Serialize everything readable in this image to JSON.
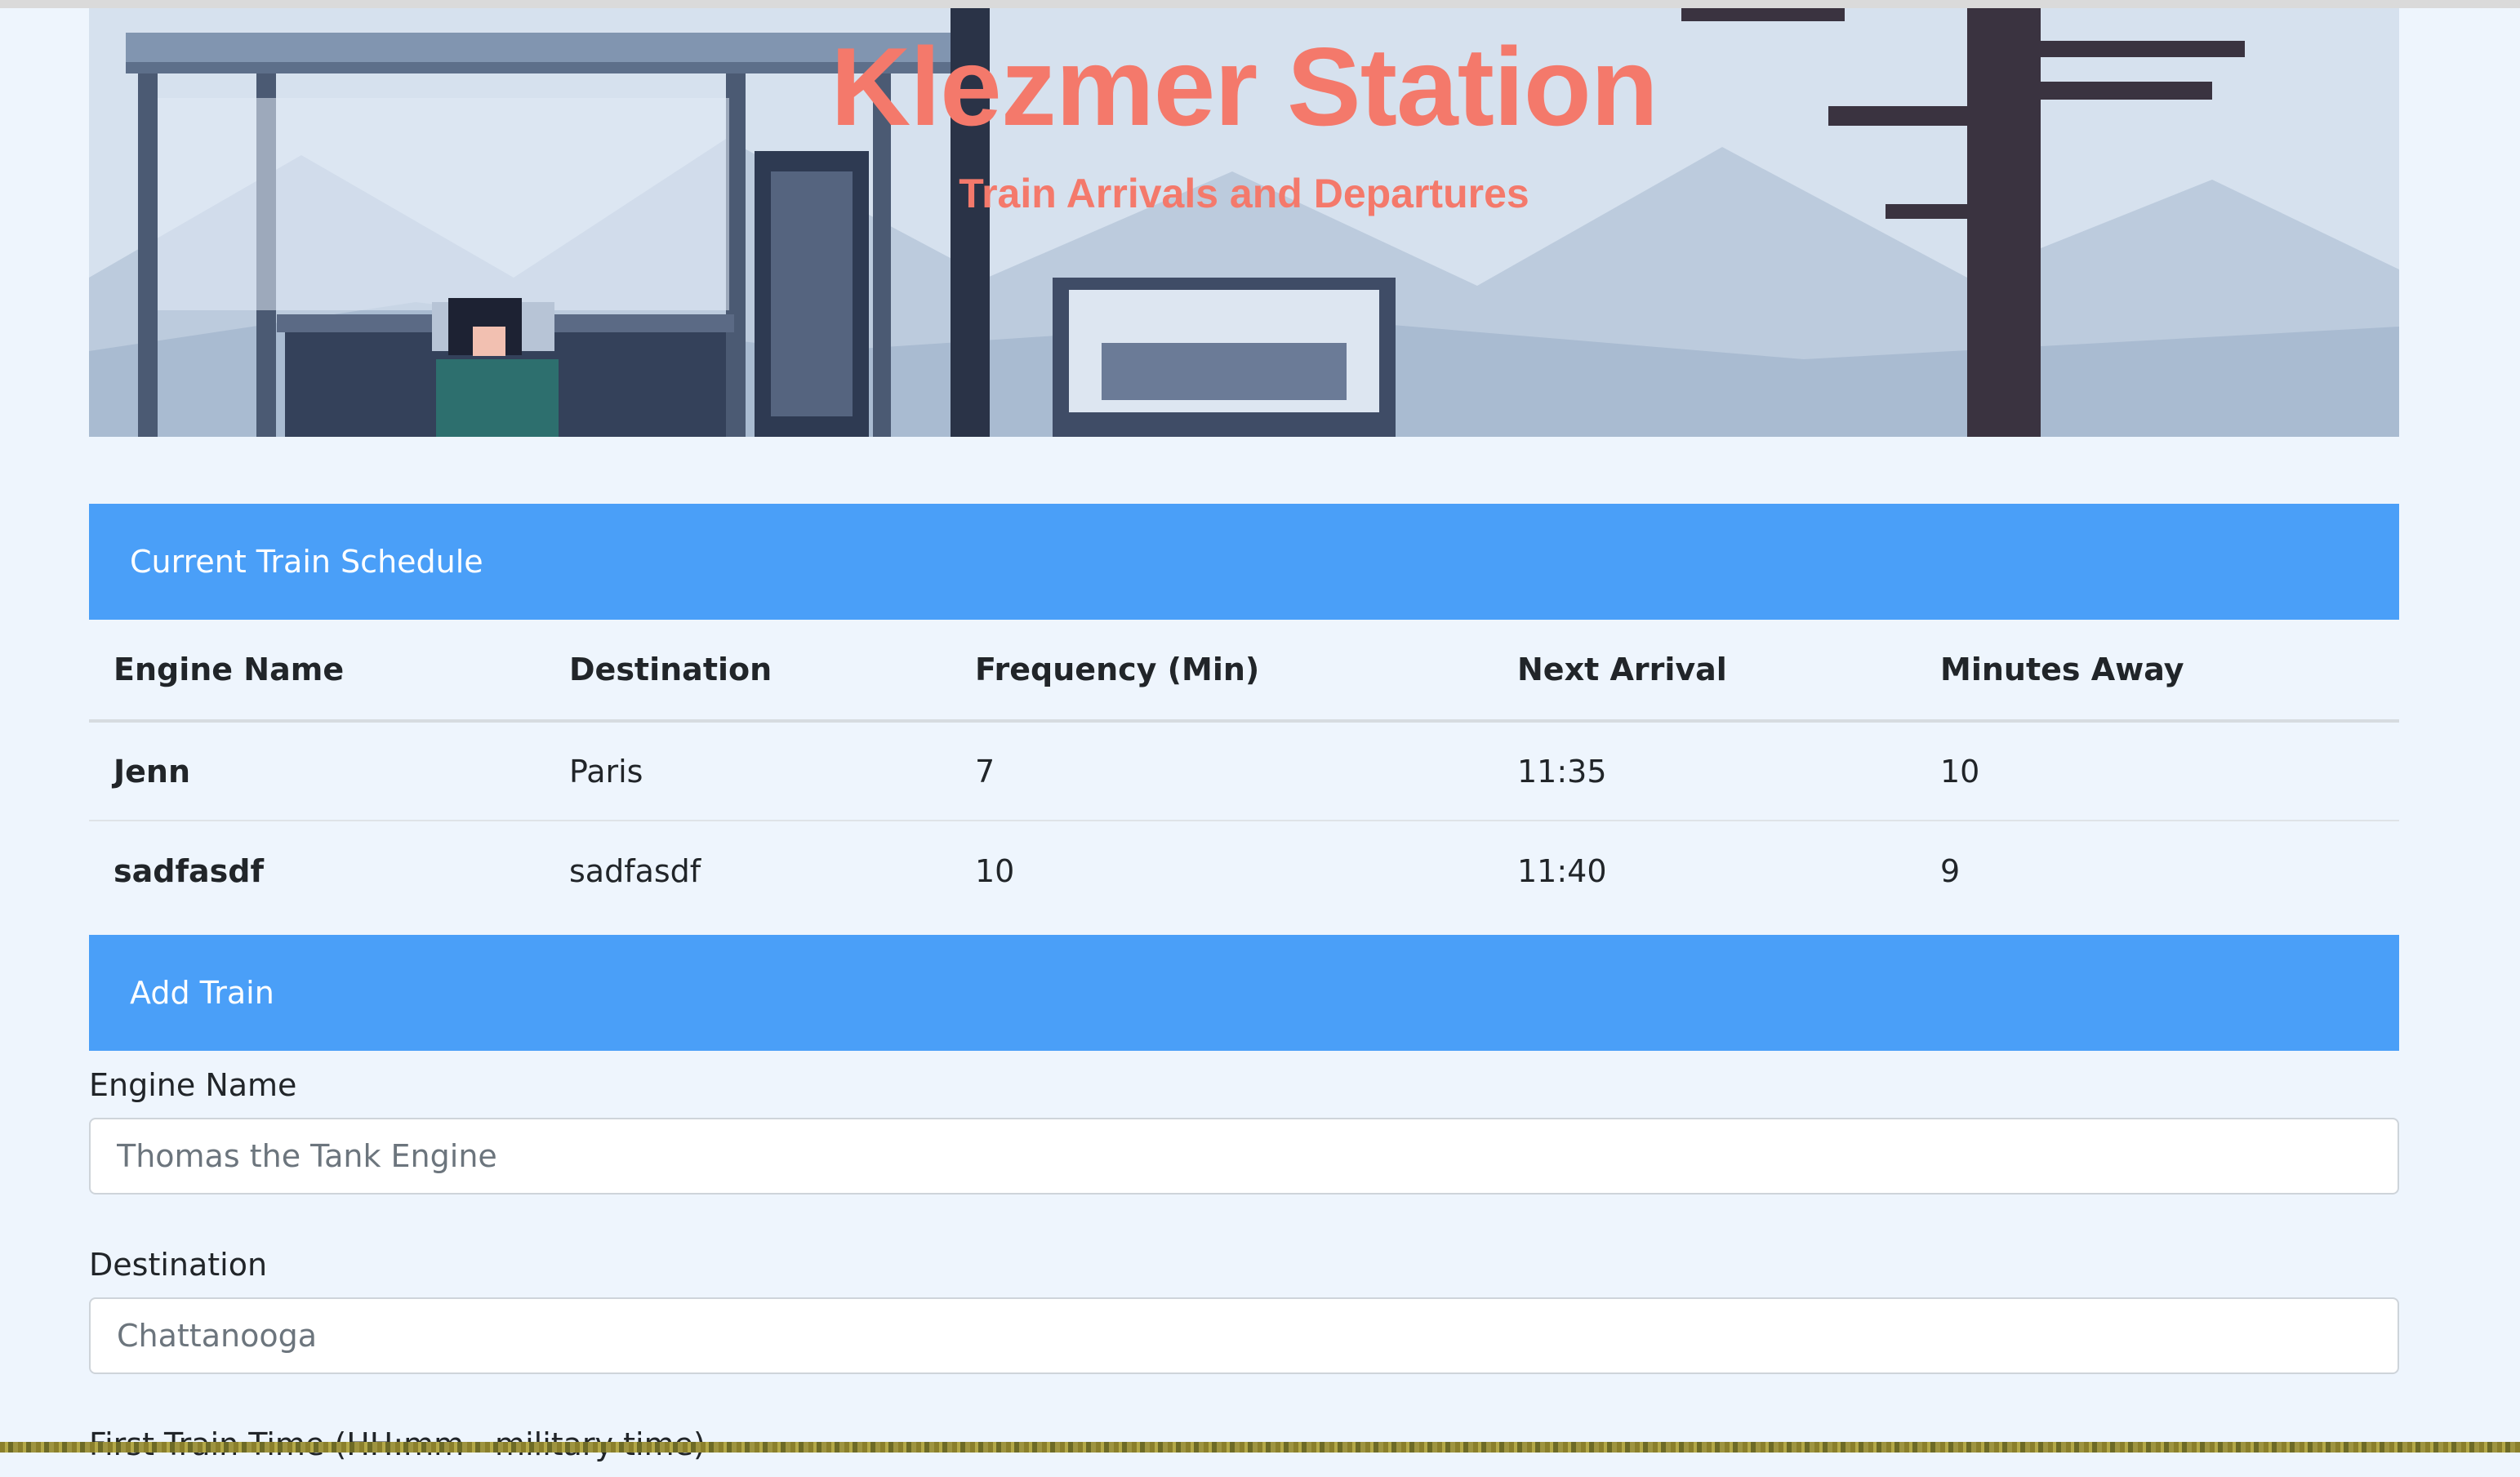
{
  "banner": {
    "title": "Klezmer Station",
    "subtitle": "Train Arrivals and Departures"
  },
  "schedule": {
    "header": "Current Train Schedule",
    "columns": [
      "Engine Name",
      "Destination",
      "Frequency (Min)",
      "Next Arrival",
      "Minutes Away"
    ],
    "rows": [
      [
        "Jenn",
        "Paris",
        "7",
        "11:35",
        "10"
      ],
      [
        "sadfasdf",
        "sadfasdf",
        "10",
        "11:40",
        "9"
      ]
    ]
  },
  "add_train": {
    "header": "Add Train",
    "fields": [
      {
        "label": "Engine Name",
        "placeholder": "Thomas the Tank Engine"
      },
      {
        "label": "Destination",
        "placeholder": "Chattanooga"
      },
      {
        "label": "First Train Time (HH:mm - military time)",
        "placeholder": ""
      }
    ]
  },
  "colors": {
    "accent": "#4a9ff8",
    "title": "#f4796b",
    "page_background": "#eef5fd"
  }
}
